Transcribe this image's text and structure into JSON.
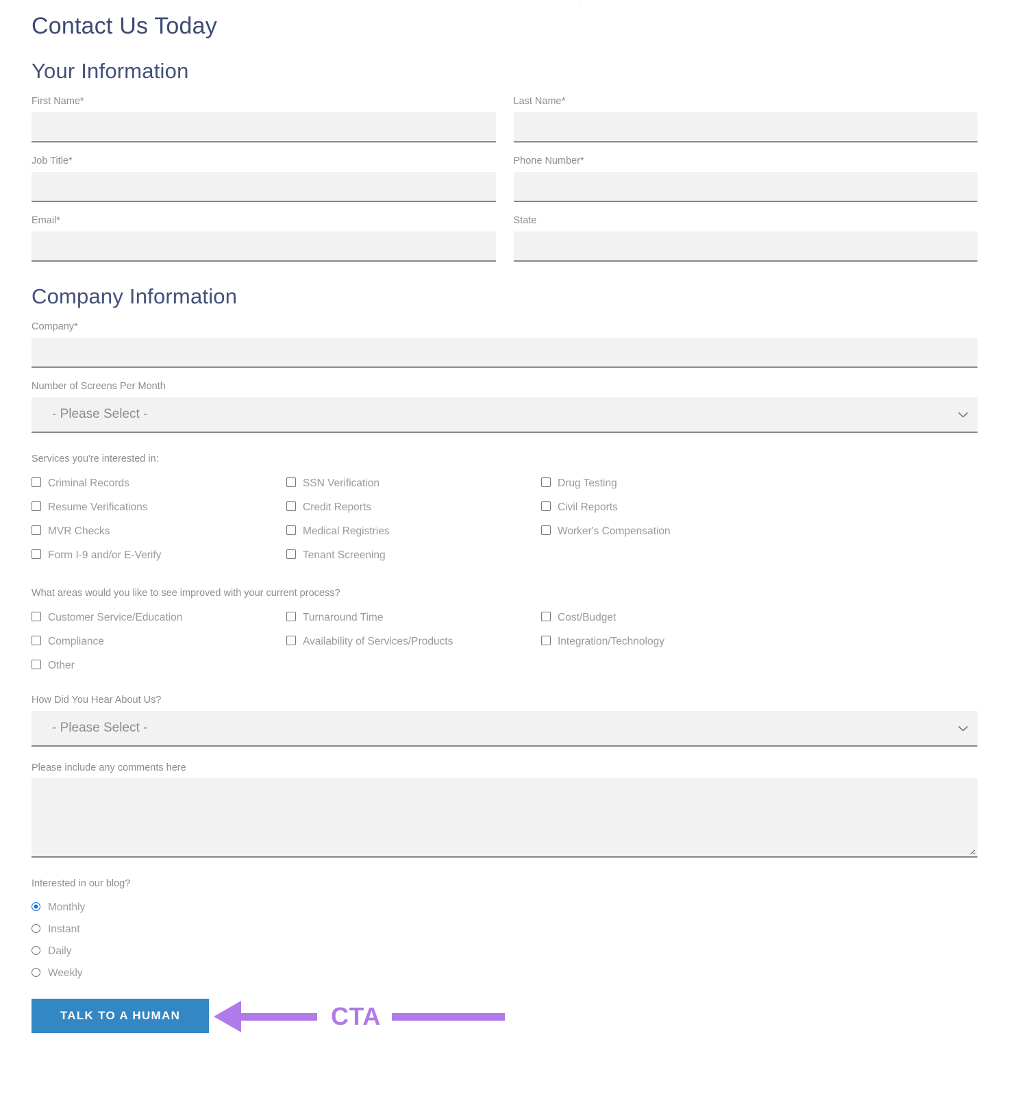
{
  "page": {
    "title": "Contact Us Today",
    "section_your_information": "Your Information",
    "section_company_information": "Company Information"
  },
  "colors": {
    "heading": "#3d4a72",
    "label": "#8d8d8d",
    "field_bg": "#f2f2f2",
    "field_underline": "#898989",
    "cta_bg": "#3287c4",
    "cta_text": "#ffffff",
    "annotation": "#b07ae8",
    "radio_selected": "#1a73d4"
  },
  "your_information": {
    "first_name": {
      "label": "First Name*",
      "value": "",
      "placeholder": ""
    },
    "last_name": {
      "label": "Last Name*",
      "value": "",
      "placeholder": ""
    },
    "job_title": {
      "label": "Job Title*",
      "value": "",
      "placeholder": ""
    },
    "phone_number": {
      "label": "Phone Number*",
      "value": "",
      "placeholder": ""
    },
    "email": {
      "label": "Email*",
      "value": "",
      "placeholder": ""
    },
    "state": {
      "label": "State",
      "value": "",
      "placeholder": ""
    }
  },
  "company_information": {
    "company": {
      "label": "Company*",
      "value": "",
      "placeholder": ""
    },
    "screens_per_month": {
      "label": "Number of Screens Per Month",
      "selected": "- Please Select -",
      "icon": "chevron-down-icon"
    },
    "how_did_you_hear": {
      "label": "How Did You Hear About Us?",
      "selected": "- Please Select -",
      "icon": "chevron-down-icon"
    },
    "comments": {
      "label": "Please include any comments here",
      "value": "",
      "placeholder": ""
    }
  },
  "services": {
    "label": "Services you're interested in:",
    "items": [
      {
        "label": "Criminal Records",
        "checked": false
      },
      {
        "label": "SSN Verification",
        "checked": false
      },
      {
        "label": "Drug Testing",
        "checked": false
      },
      {
        "label": "Resume Verifications",
        "checked": false
      },
      {
        "label": "Credit Reports",
        "checked": false
      },
      {
        "label": "Civil Reports",
        "checked": false
      },
      {
        "label": "MVR Checks",
        "checked": false
      },
      {
        "label": "Medical Registries",
        "checked": false
      },
      {
        "label": "Worker's Compensation",
        "checked": false
      },
      {
        "label": "Form I-9 and/or E-Verify",
        "checked": false
      },
      {
        "label": "Tenant Screening",
        "checked": false
      },
      {
        "label": "",
        "checked": false
      }
    ]
  },
  "improvements": {
    "label": "What areas would you like to see improved with your current process?",
    "items": [
      {
        "label": "Customer Service/Education",
        "checked": false
      },
      {
        "label": "Turnaround Time",
        "checked": false
      },
      {
        "label": "Cost/Budget",
        "checked": false
      },
      {
        "label": "Compliance",
        "checked": false
      },
      {
        "label": "Availability of Services/Products",
        "checked": false
      },
      {
        "label": "Integration/Technology",
        "checked": false
      },
      {
        "label": "Other",
        "checked": false
      },
      {
        "label": "",
        "checked": false
      },
      {
        "label": "",
        "checked": false
      }
    ]
  },
  "blog": {
    "label": "Interested in our blog?",
    "options": [
      {
        "label": "Monthly",
        "selected": true
      },
      {
        "label": "Instant",
        "selected": false
      },
      {
        "label": "Daily",
        "selected": false
      },
      {
        "label": "Weekly",
        "selected": false
      }
    ]
  },
  "cta": {
    "button_label": "Talk to a Human",
    "annotation_label": "CTA"
  }
}
